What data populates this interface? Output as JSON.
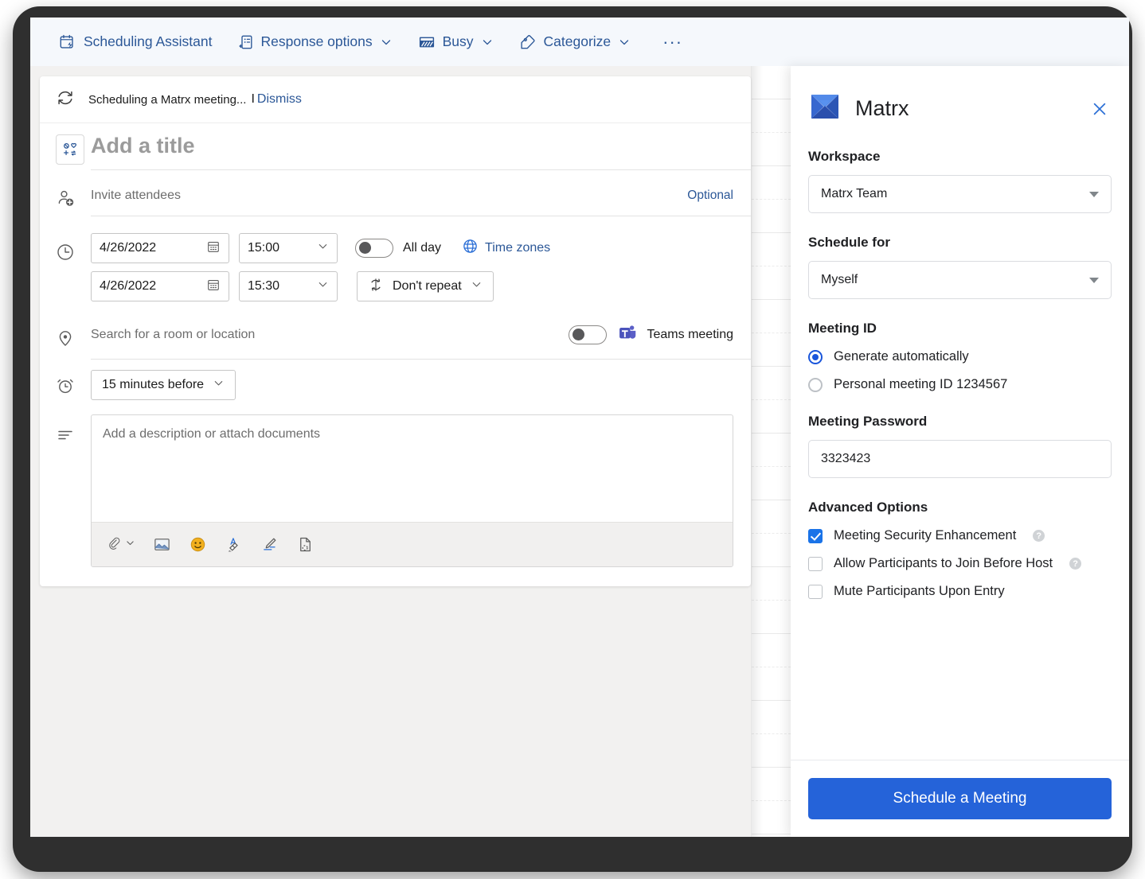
{
  "commandbar": {
    "items": [
      {
        "label": "Scheduling Assistant",
        "icon": "calendar-lightning-icon",
        "caret": false
      },
      {
        "label": "Response options",
        "icon": "response-options-icon",
        "caret": true
      },
      {
        "label": "Busy",
        "icon": "busy-status-icon",
        "caret": true
      },
      {
        "label": "Categorize",
        "icon": "tag-icon",
        "caret": true
      }
    ],
    "overflow_label": "···"
  },
  "notice": {
    "icon": "sync-refresh-icon",
    "text": "Scheduling a Matrx meeting...",
    "separator": "I",
    "dismiss_label": "Dismiss"
  },
  "form": {
    "title": {
      "icon": "event-type-icon",
      "placeholder": "Add a title"
    },
    "attendees": {
      "icon": "add-person-icon",
      "placeholder": "Invite attendees",
      "optional_label": "Optional"
    },
    "datetime": {
      "icon": "clock-icon",
      "start_date": "4/26/2022",
      "start_time": "15:00",
      "end_date": "4/26/2022",
      "end_time": "15:30",
      "allday_label": "All day",
      "allday_on": false,
      "timezones_label": "Time zones",
      "timezones_icon": "globe-icon",
      "repeat_label": "Don't repeat",
      "repeat_icon": "repeat-icon",
      "date_icon": "calendar-picker-icon"
    },
    "location": {
      "icon": "location-pin-icon",
      "placeholder": "Search for a room or location",
      "teams_label": "Teams meeting",
      "teams_icon": "microsoft-teams-icon",
      "teams_on": false
    },
    "reminder": {
      "icon": "alarm-clock-icon",
      "value": "15 minutes before"
    },
    "description": {
      "icon": "description-lines-icon",
      "placeholder": "Add a description or attach documents",
      "tools": [
        {
          "name": "attach-file-icon",
          "caret": true
        },
        {
          "name": "insert-picture-icon",
          "caret": false
        },
        {
          "name": "emoji-icon",
          "caret": false
        },
        {
          "name": "text-highlight-icon",
          "caret": false
        },
        {
          "name": "signature-pen-icon",
          "caret": false
        },
        {
          "name": "insert-document-icon",
          "caret": false
        }
      ]
    }
  },
  "panel": {
    "brand_name": "Matrx",
    "brand_icon": "matrx-bowtie-logo",
    "close_icon": "close-icon",
    "workspace": {
      "title": "Workspace",
      "value": "Matrx Team"
    },
    "schedule_for": {
      "title": "Schedule for",
      "value": "Myself"
    },
    "meeting_id": {
      "title": "Meeting ID",
      "options": [
        {
          "label": "Generate automatically",
          "selected": true
        },
        {
          "label": "Personal meeting ID 1234567",
          "selected": false
        }
      ]
    },
    "meeting_password": {
      "title": "Meeting Password",
      "value": "3323423"
    },
    "advanced": {
      "title": "Advanced Options",
      "options": [
        {
          "label": "Meeting Security Enhancement",
          "checked": true,
          "help": true
        },
        {
          "label": "Allow Participants to Join Before Host",
          "checked": false,
          "help": true
        },
        {
          "label": "Mute Participants Upon Entry",
          "checked": false,
          "help": false
        }
      ]
    },
    "submit_label": "Schedule a Meeting"
  },
  "colors": {
    "command_text": "#2b5797",
    "command_bg": "#f5f8fc",
    "link": "#2b5797",
    "primary_button": "#2563d9",
    "accent_checkbox": "#1a73e8",
    "accent_radio": "#1a56db",
    "page_bg": "#f2f1f0",
    "bezel": "#2f2f2f"
  }
}
